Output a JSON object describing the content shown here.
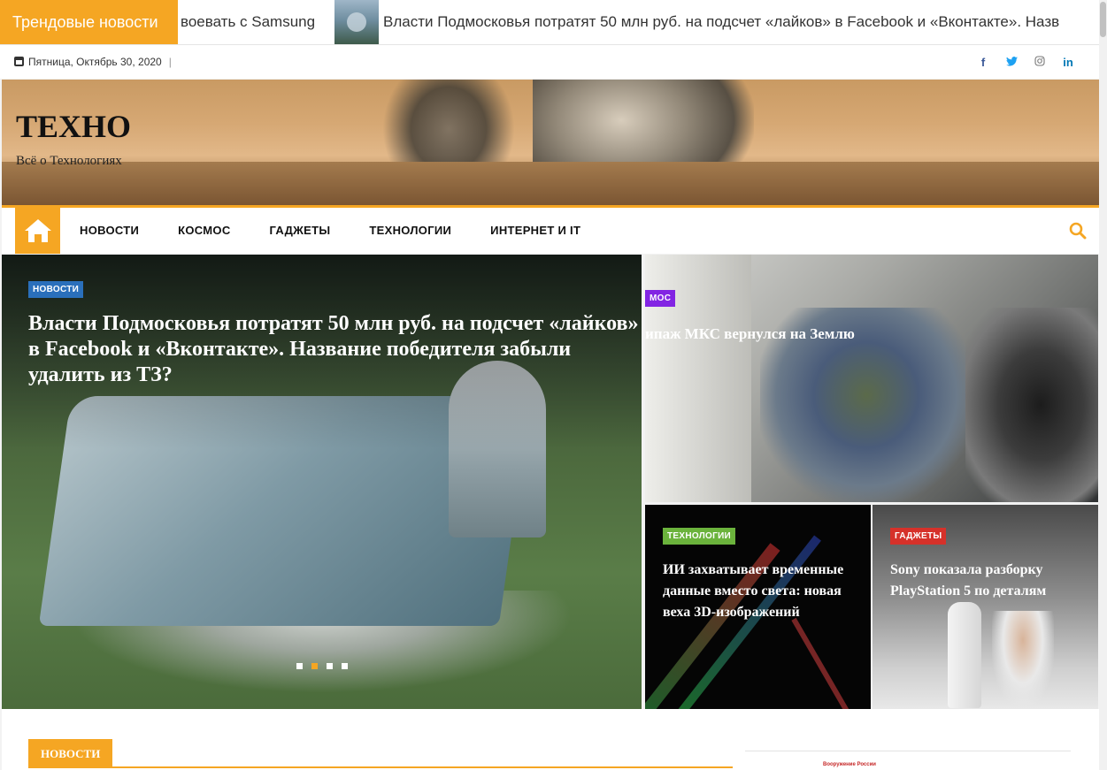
{
  "ticker": {
    "label": "Трендовые новости",
    "items": [
      "воевать с Samsung",
      "Власти Подмосковья потратят 50 млн руб. на подсчет «лайков» в Facebook и «Вконтакте». Назв"
    ]
  },
  "topbar": {
    "date": "Пятница, Октябрь 30, 2020",
    "social": [
      {
        "name": "facebook-icon",
        "glyph": "f"
      },
      {
        "name": "twitter-icon",
        "glyph": "🐦"
      },
      {
        "name": "instagram-icon",
        "glyph": "◎"
      },
      {
        "name": "linkedin-icon",
        "glyph": "in"
      }
    ]
  },
  "header": {
    "title": "ТЕХНО",
    "description": "Всё о Технологиях"
  },
  "nav": {
    "items": [
      "НОВОСТИ",
      "КОСМОС",
      "ГАДЖЕТЫ",
      "ТЕХНОЛОГИИ",
      "ИНТЕРНЕТ И IT"
    ]
  },
  "slider": {
    "main": {
      "category": "НОВОСТИ",
      "title": "Власти Подмосковья потратят 50 млн руб. на подсчет «лайков» в Facebook и «Вконтакте». Название победителя забыли удалить из ТЗ?"
    },
    "active_dot": 2,
    "dot_count": 4
  },
  "side": {
    "top": {
      "category": "МОС",
      "title": "ипаж МКС вернулся на Землю"
    },
    "bottom_left": {
      "category": "ТЕХНОЛОГИИ",
      "title": "ИИ захватывает временные данные вместо света: новая веха 3D-изображений"
    },
    "bottom_right": {
      "category": "ГАДЖЕТЫ",
      "title": "Sony показала разборку PlayStation 5 по деталям"
    }
  },
  "lower": {
    "section_label": "НОВОСТИ",
    "sidebar_label": "Вооружение России"
  },
  "colors": {
    "accent": "#f5a623",
    "cat_news": "#2a6fbb",
    "cat_space": "#8224e3",
    "cat_tech": "#6bb33c",
    "cat_gadgets": "#d6312a"
  }
}
